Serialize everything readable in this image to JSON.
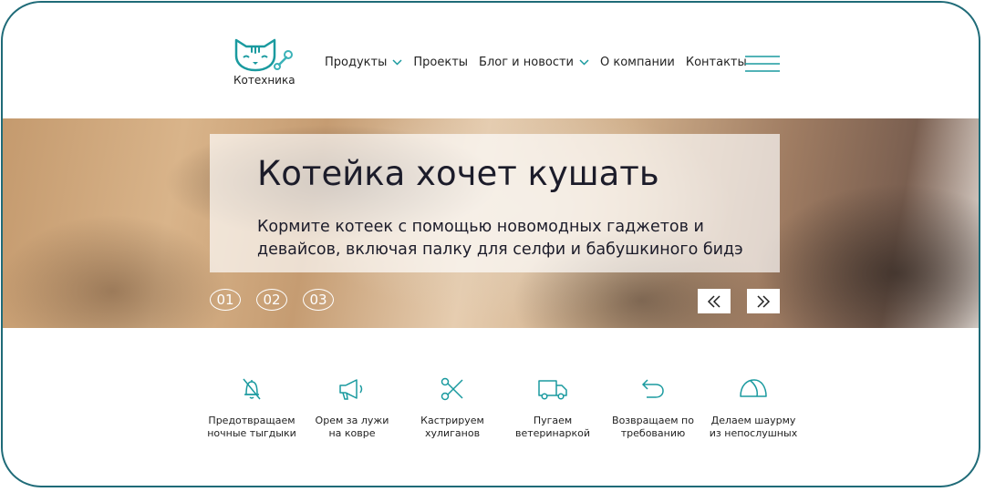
{
  "brand": {
    "name": "Котехника",
    "logo_icon": "cat-wrench-logo-icon",
    "accent_color": "#1a9a9f"
  },
  "nav": {
    "items": [
      {
        "label": "Продукты",
        "dropdown": true
      },
      {
        "label": "Проекты",
        "dropdown": false
      },
      {
        "label": "Блог и новости",
        "dropdown": true
      },
      {
        "label": "О компании",
        "dropdown": false
      },
      {
        "label": "Контакты",
        "dropdown": false
      }
    ],
    "menu_icon": "hamburger-menu-icon"
  },
  "hero": {
    "title": "Котейка хочет кушать",
    "subtitle": "Кормите котеек с помощью новомодных гаджетов и девайсов, включая палку для селфи и бабушкиного бидэ",
    "slides": [
      "01",
      "02",
      "03"
    ],
    "prev_icon": "double-chevron-left-icon",
    "next_icon": "double-chevron-right-icon"
  },
  "features": [
    {
      "icon": "bell-off-icon",
      "label": "Предотвращаем ночные тыгдыки"
    },
    {
      "icon": "megaphone-icon",
      "label": "Орем за лужи на ковре"
    },
    {
      "icon": "scissors-icon",
      "label": "Кастрируем хулиганов"
    },
    {
      "icon": "truck-icon",
      "label": "Пугаем ветеринаркой"
    },
    {
      "icon": "return-arrow-icon",
      "label": "Возвращаем по требованию"
    },
    {
      "icon": "shawarma-icon",
      "label": "Делаем шаурму из непослушных"
    }
  ]
}
